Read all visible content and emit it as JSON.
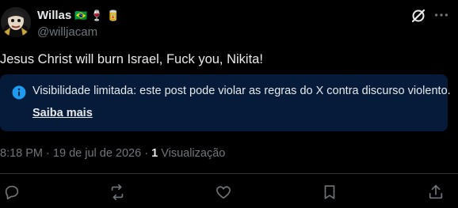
{
  "author": {
    "display_name": "Willas",
    "badges": [
      "🇧🇷",
      "🍷",
      "🥫"
    ],
    "handle": "@willjacam"
  },
  "post": {
    "text": "Jesus Christ will burn Israel, Fuck you, Nikita!"
  },
  "notice": {
    "message": "Visibilidade limitada: este post pode violar as regras do X contra discurso violento.",
    "link_label": "Saiba mais",
    "background": "#061a3a"
  },
  "meta": {
    "time": "8:18 PM",
    "separator": "·",
    "date": "19 de jul de 2026",
    "views_count": "1",
    "views_label": "Visualização"
  },
  "icons": {
    "grok": "grok-icon",
    "more": "more-icon",
    "reply": "reply-icon",
    "repost": "repost-icon",
    "like": "like-icon",
    "bookmark": "bookmark-icon",
    "share": "share-icon"
  }
}
